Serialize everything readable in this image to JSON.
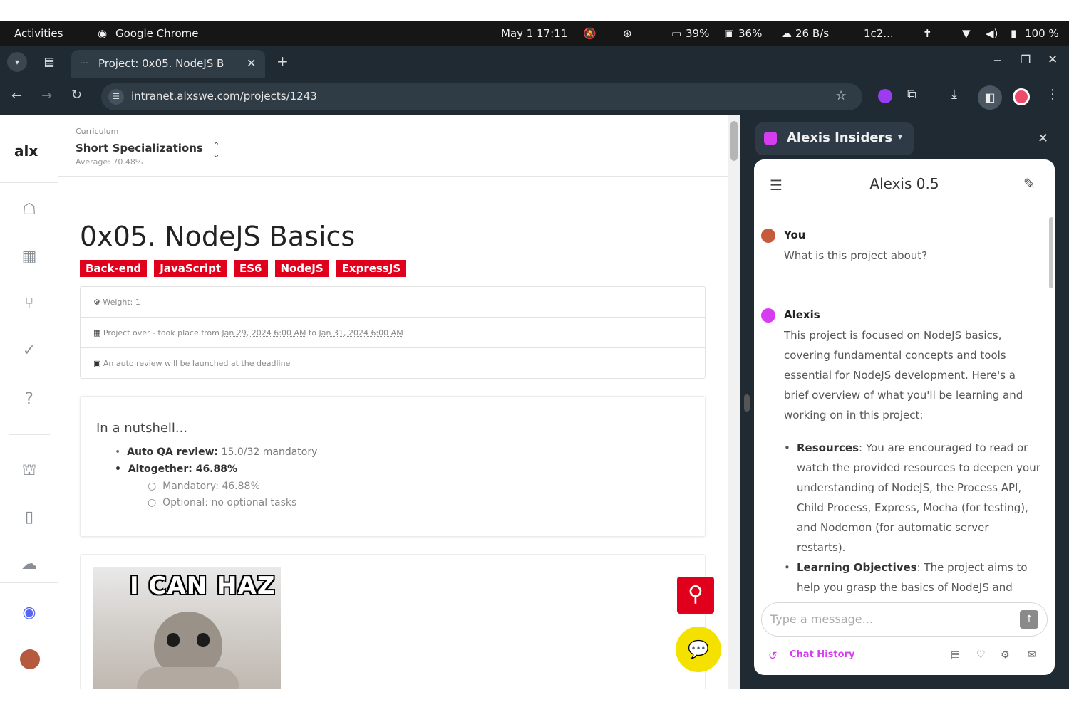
{
  "os_bar": {
    "activities": "Activities",
    "app_name": "Google Chrome",
    "datetime": "May 1  17:11",
    "cpu": "39%",
    "mem": "36%",
    "net": "26 B/s",
    "extra": "1c2...",
    "battery": "100 %"
  },
  "browser": {
    "tab_title": "Project: 0x05. NodeJS B",
    "url": "intranet.alxswe.com/projects/1243"
  },
  "header": {
    "logo": "alx",
    "curriculum_label": "Curriculum",
    "curriculum_name": "Short Specializations",
    "average": "Average: 70.48%"
  },
  "project": {
    "title": "0x05. NodeJS Basics",
    "tags": [
      "Back-end",
      "JavaScript",
      "ES6",
      "NodeJS",
      "ExpressJS"
    ],
    "tag_color": "#e0001b",
    "weight": "Weight: 1",
    "project_over": "Project over - took place from ",
    "date_start": "Jan 29, 2024 6:00 AM",
    "date_to": " to ",
    "date_end": "Jan 31, 2024 6:00 AM",
    "auto_review": "An auto review will be launched at the deadline"
  },
  "nutshell": {
    "heading": "In a nutshell...",
    "auto_qa_label": "Auto QA review:",
    "auto_qa_value": " 15.0/32 mandatory",
    "altogether_label": "Altogether: ",
    "altogether_value": "46.88%",
    "mandatory": "Mandatory: 46.88%",
    "optional": "Optional: no optional tasks"
  },
  "meme": {
    "caption": "I CAN HAZ"
  },
  "chat": {
    "workspace": "Alexis Insiders",
    "title": "Alexis 0.5",
    "user_name": "You",
    "user_message": "What is this project about?",
    "bot_name": "Alexis",
    "bot_intro": "This project is focused on NodeJS basics, covering fundamental concepts and tools essential for NodeJS development. Here's a brief overview of what you'll be learning and working on in this project:",
    "bullets": [
      {
        "label": "Resources",
        "text": ": You are encouraged to read or watch the provided resources to deepen your understanding of NodeJS, the Process API, Child Process, Express, Mocha (for testing), and Nodemon (for automatic server restarts)."
      },
      {
        "label": "Learning Objectives",
        "text": ": The project aims to help you grasp the basics of NodeJS and related tools, enabling you to build and test"
      }
    ],
    "input_placeholder": "Type a message...",
    "chat_history": "Chat History",
    "accent": "#d63cf0"
  }
}
